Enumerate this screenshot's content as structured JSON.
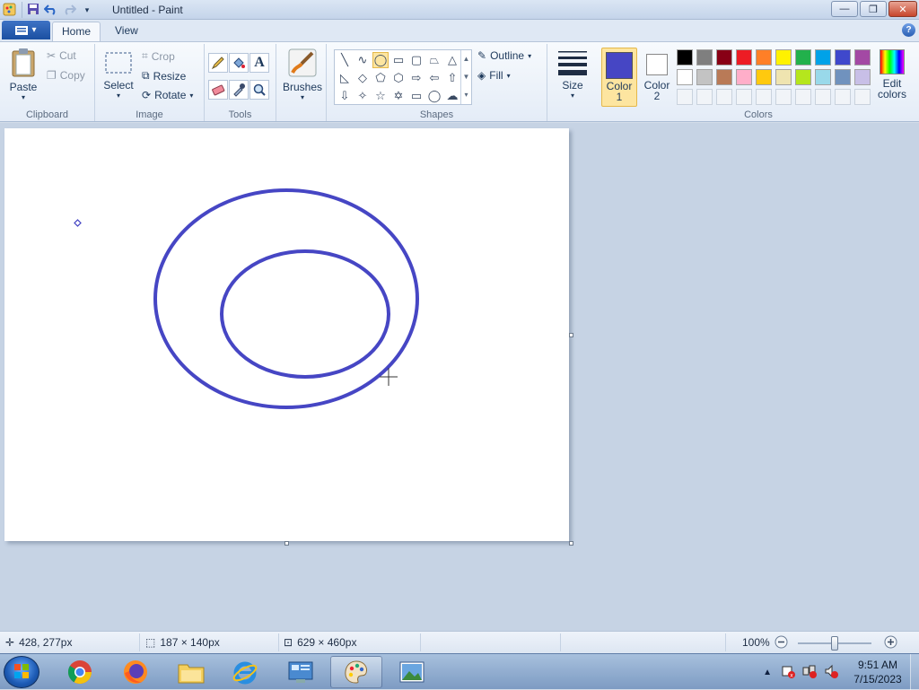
{
  "window": {
    "title": "Untitled - Paint"
  },
  "tabs": {
    "file": "",
    "home": "Home",
    "view": "View"
  },
  "clipboard": {
    "paste": "Paste",
    "cut": "Cut",
    "copy": "Copy",
    "label": "Clipboard"
  },
  "image": {
    "select": "Select",
    "crop": "Crop",
    "resize": "Resize",
    "rotate": "Rotate",
    "label": "Image"
  },
  "tools": {
    "label": "Tools"
  },
  "brushes": {
    "label": "Brushes"
  },
  "shapes": {
    "outline": "Outline",
    "fill": "Fill",
    "label": "Shapes"
  },
  "size": {
    "label": "Size"
  },
  "colors": {
    "color1_a": "Color",
    "color1_b": "1",
    "color2_a": "Color",
    "color2_b": "2",
    "edit_a": "Edit",
    "edit_b": "colors",
    "label": "Colors",
    "color1": "#4646c4",
    "color2": "#ffffff",
    "palette_row1": [
      "#000000",
      "#7f7f7f",
      "#880015",
      "#ed1c24",
      "#ff7f27",
      "#fff200",
      "#22b14c",
      "#00a2e8",
      "#3f48cc",
      "#a349a4"
    ],
    "palette_row2": [
      "#ffffff",
      "#c3c3c3",
      "#b97a57",
      "#ffaec9",
      "#ffc90e",
      "#efe4b0",
      "#b5e61d",
      "#99d9ea",
      "#7092be",
      "#c8bfe7"
    ]
  },
  "status": {
    "cursor": "428, 277px",
    "selection": "187 × 140px",
    "canvas_size": "629 × 460px",
    "zoom": "100%"
  },
  "taskbar": {
    "time": "9:51 AM",
    "date": "7/15/2023"
  }
}
